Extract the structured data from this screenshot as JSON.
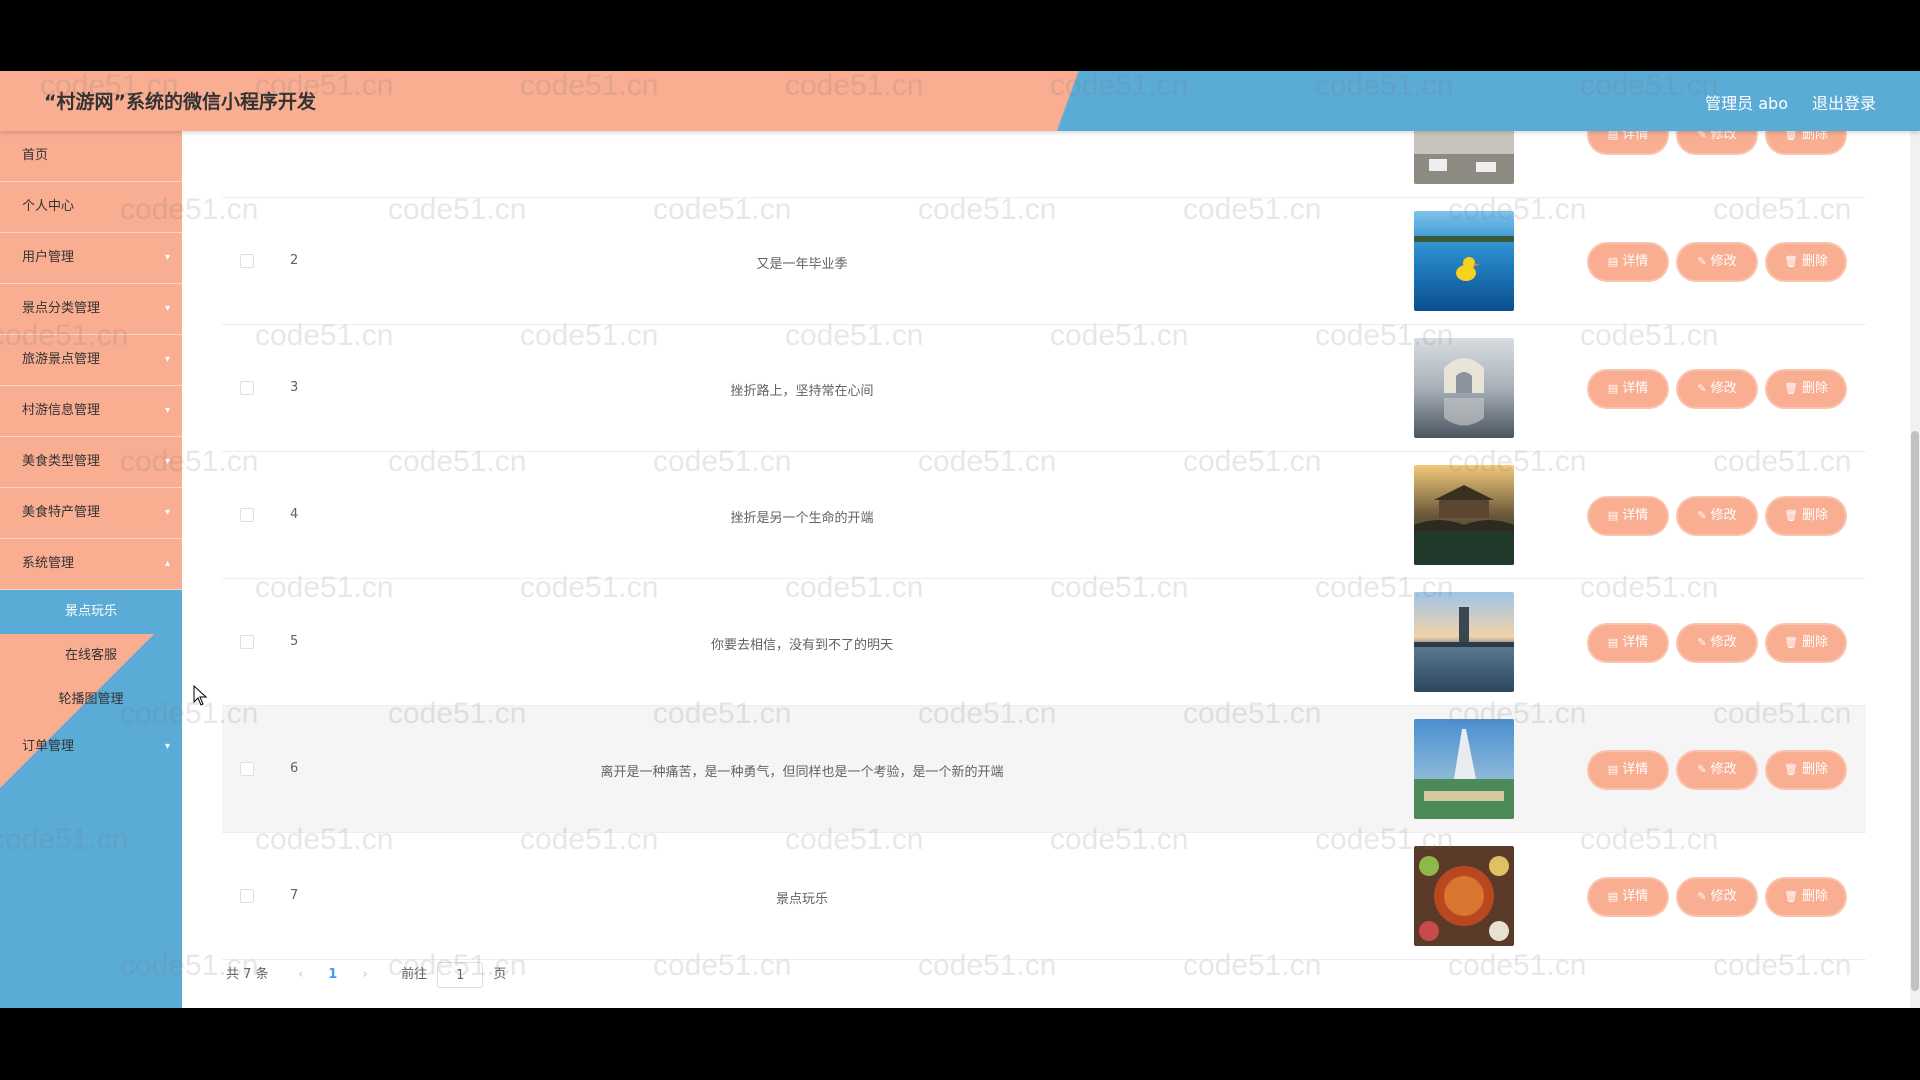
{
  "header": {
    "title": "“村游网”系统的微信小程序开发",
    "admin": "管理员 abo",
    "logout": "退出登录"
  },
  "sidebar": {
    "items": [
      {
        "label": "首页",
        "has_children": false
      },
      {
        "label": "个人中心",
        "has_children": false
      },
      {
        "label": "用户管理",
        "has_children": true
      },
      {
        "label": "景点分类管理",
        "has_children": true
      },
      {
        "label": "旅游景点管理",
        "has_children": true
      },
      {
        "label": "村游信息管理",
        "has_children": true
      },
      {
        "label": "美食类型管理",
        "has_children": true
      },
      {
        "label": "美食特产管理",
        "has_children": true
      },
      {
        "label": "系统管理",
        "has_children": true
      }
    ],
    "sub_items": [
      {
        "label": "景点玩乐",
        "active": true
      },
      {
        "label": "在线客服",
        "active": false
      },
      {
        "label": "轮播图管理",
        "active": false
      }
    ],
    "last_item": {
      "label": "订单管理",
      "has_children": true
    }
  },
  "table": {
    "rows": [
      {
        "index": "",
        "title": "",
        "thumb": "ruins"
      },
      {
        "index": "2",
        "title": "又是一年毕业季",
        "thumb": "pool-duck"
      },
      {
        "index": "3",
        "title": "挫折路上，坚持常在心间",
        "thumb": "gate-reflection"
      },
      {
        "index": "4",
        "title": "挫折是另一个生命的开端",
        "thumb": "bridge-pavilion"
      },
      {
        "index": "5",
        "title": "你要去相信，没有到不了的明天",
        "thumb": "pagoda-lake"
      },
      {
        "index": "6",
        "title": "离开是一种痛苦，是一种勇气，但同样也是一个考验，是一个新的开端",
        "thumb": "burj-al-arab"
      },
      {
        "index": "7",
        "title": "景点玩乐",
        "thumb": "hotpot-food"
      }
    ],
    "buttons": {
      "detail": "详情",
      "edit": "修改",
      "delete": "删除"
    }
  },
  "pagination": {
    "total": "共 7 条",
    "current": "1",
    "goto_prefix": "前往",
    "goto_value": "1",
    "goto_suffix": "页"
  },
  "watermark": "code51.cn",
  "colors": {
    "salmon": "#f9ad91",
    "blue": "#5aabd6"
  }
}
